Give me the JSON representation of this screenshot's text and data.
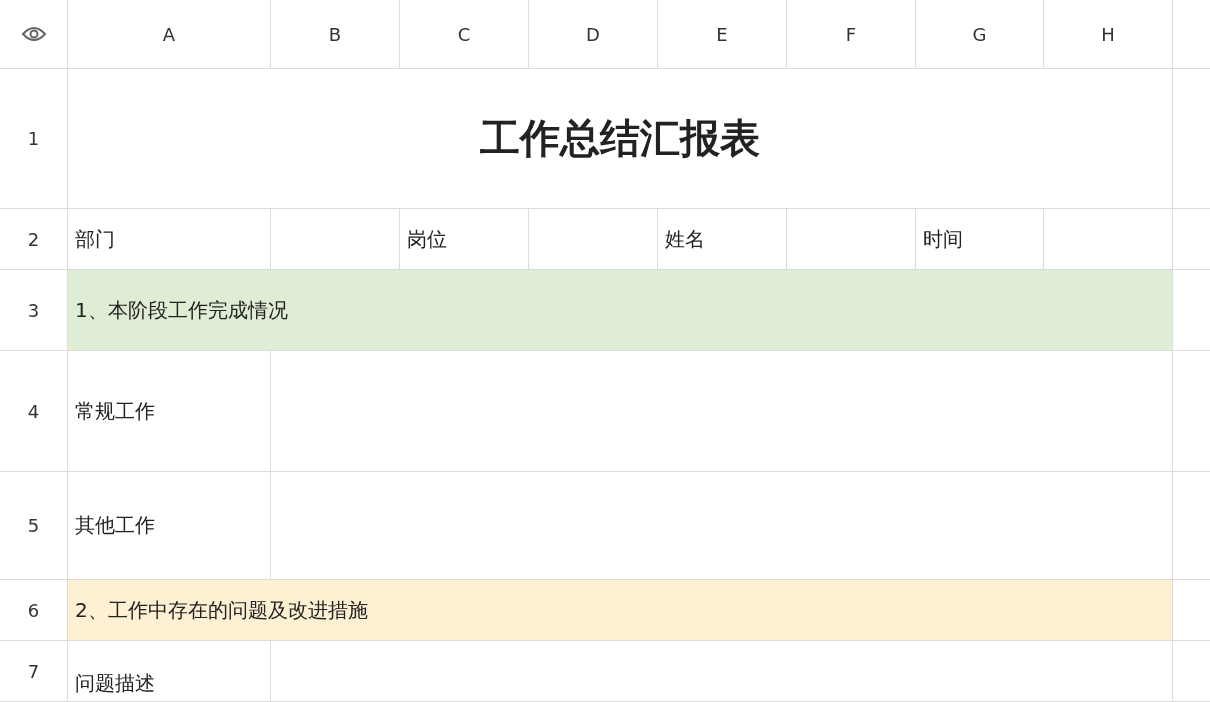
{
  "columns": [
    "A",
    "B",
    "C",
    "D",
    "E",
    "F",
    "G",
    "H"
  ],
  "rows": [
    {
      "number": "1",
      "cells": [
        {
          "kind": "title",
          "text": "工作总结汇报表"
        }
      ]
    },
    {
      "number": "2",
      "cells": [
        {
          "kind": "label",
          "text": "部门"
        },
        {
          "kind": "blank"
        },
        {
          "kind": "label",
          "text": "岗位"
        },
        {
          "kind": "blank"
        },
        {
          "kind": "label",
          "text": "姓名"
        },
        {
          "kind": "blank"
        },
        {
          "kind": "label",
          "text": "时间"
        },
        {
          "kind": "blank"
        }
      ]
    },
    {
      "number": "3",
      "cells": [
        {
          "kind": "section",
          "text": "1、本阶段工作完成情况",
          "color": "#e0edd5"
        }
      ]
    },
    {
      "number": "4",
      "cells": [
        {
          "kind": "label",
          "text": "常规工作"
        },
        {
          "kind": "wide-blank"
        }
      ]
    },
    {
      "number": "5",
      "cells": [
        {
          "kind": "label",
          "text": "其他工作"
        },
        {
          "kind": "wide-blank"
        }
      ]
    },
    {
      "number": "6",
      "cells": [
        {
          "kind": "section",
          "text": "2、工作中存在的问题及改进措施",
          "color": "#fdf0d3"
        }
      ]
    },
    {
      "number": "7",
      "cells": [
        {
          "kind": "label",
          "text": "问题描述"
        },
        {
          "kind": "wide-blank"
        }
      ]
    }
  ]
}
